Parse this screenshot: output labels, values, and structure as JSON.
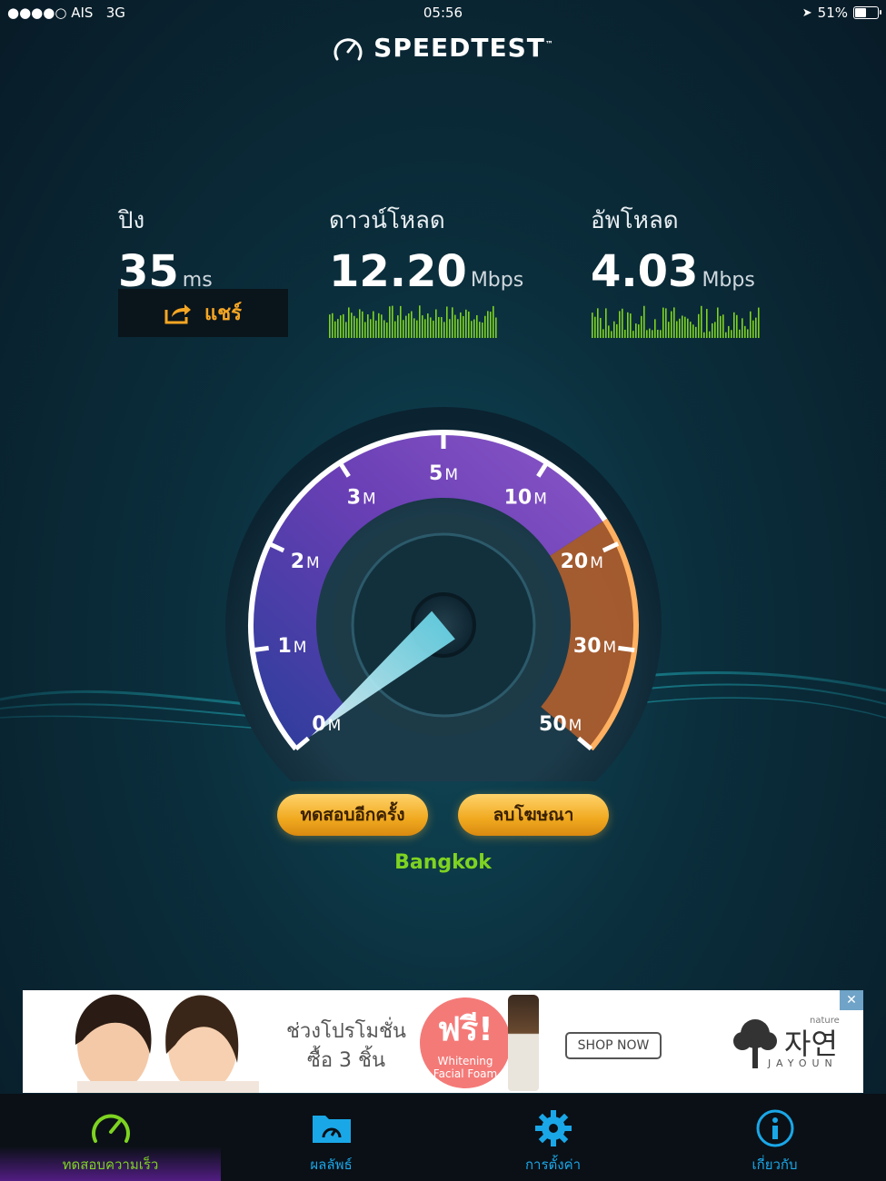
{
  "status_bar": {
    "carrier": "●●●●○ AIS",
    "network": "3G",
    "time": "05:56",
    "battery": "51%"
  },
  "app": {
    "title": "SPEEDTEST",
    "trademark": "™"
  },
  "results": {
    "ping": {
      "label": "ปิง",
      "value": "35",
      "unit": "ms"
    },
    "download": {
      "label": "ดาวน์โหลด",
      "value": "12.20",
      "unit": "Mbps"
    },
    "upload": {
      "label": "อัพโหลด",
      "value": "4.03",
      "unit": "Mbps"
    }
  },
  "share_button": {
    "label": "แชร์"
  },
  "gauge": {
    "ticks": [
      {
        "num": "0",
        "unit": "M"
      },
      {
        "num": "1",
        "unit": "M"
      },
      {
        "num": "2",
        "unit": "M"
      },
      {
        "num": "3",
        "unit": "M"
      },
      {
        "num": "5",
        "unit": "M"
      },
      {
        "num": "10",
        "unit": "M"
      },
      {
        "num": "20",
        "unit": "M"
      },
      {
        "num": "30",
        "unit": "M"
      },
      {
        "num": "50",
        "unit": "M"
      }
    ],
    "needle_value": "0"
  },
  "buttons": {
    "test_again": "ทดสอบอีกครั้ง",
    "remove_ads": "ลบโฆษณา"
  },
  "server": {
    "name": "Bangkok"
  },
  "ad": {
    "promo_line1": "ช่วงโปรโมชั่น",
    "promo_line2": "ซื้อ 3 ชิ้น",
    "free_big": "ฟรี!",
    "free_line1": "Whitening",
    "free_line2": "Facial Foam",
    "shop_now": "SHOP NOW",
    "brand_nature": "nature",
    "brand_korean": "자연",
    "brand_latin": "JAYOUN",
    "close": "✕"
  },
  "tabs": [
    {
      "label": "ทดสอบความเร็ว",
      "icon": "speedometer-icon",
      "active": true,
      "color": "#7ed321"
    },
    {
      "label": "ผลลัพธ์",
      "icon": "folder-results-icon",
      "active": false,
      "color": "#1aa7e8"
    },
    {
      "label": "การตั้งค่า",
      "icon": "gear-icon",
      "active": false,
      "color": "#1aa7e8"
    },
    {
      "label": "เกี่ยวกับ",
      "icon": "info-icon",
      "active": false,
      "color": "#1aa7e8"
    }
  ]
}
